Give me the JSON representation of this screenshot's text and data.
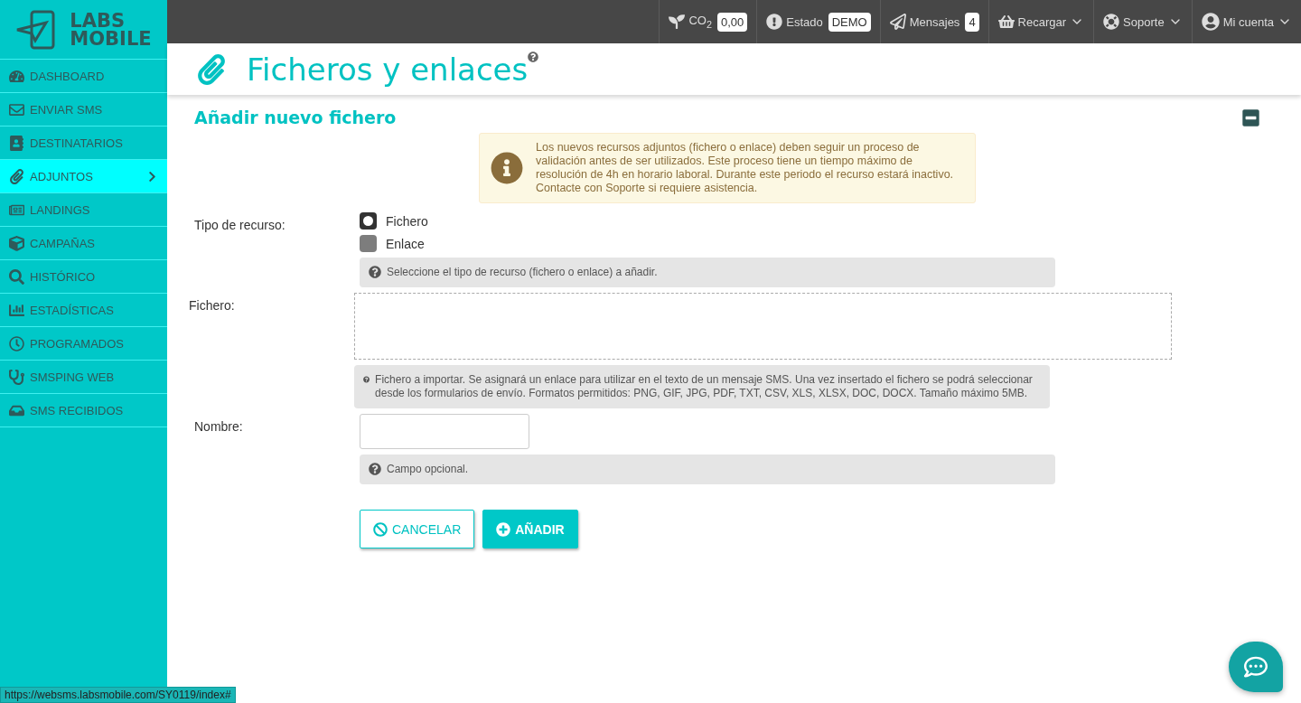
{
  "logo": {
    "line1": "LABS",
    "line2": "MOBILE"
  },
  "sidebar": {
    "items": [
      {
        "label": "DASHBOARD",
        "selected": false
      },
      {
        "label": "ENVIAR SMS",
        "selected": false
      },
      {
        "label": "DESTINATARIOS",
        "selected": false
      },
      {
        "label": "ADJUNTOS",
        "selected": true
      },
      {
        "label": "LANDINGS",
        "selected": false
      },
      {
        "label": "CAMPAÑAS",
        "selected": false
      },
      {
        "label": "HISTÓRICO",
        "selected": false
      },
      {
        "label": "ESTADÍSTICAS",
        "selected": false
      },
      {
        "label": "PROGRAMADOS",
        "selected": false
      },
      {
        "label": "SMSPING WEB",
        "selected": false
      },
      {
        "label": "SMS RECIBIDOS",
        "selected": false
      }
    ]
  },
  "topbar": {
    "items": [
      {
        "kind": "badge",
        "label": "CO$_{2}$",
        "badge": "0,00"
      },
      {
        "kind": "badge",
        "label": "Estado",
        "badge": "DEMO"
      },
      {
        "kind": "badge",
        "label": "Mensajes",
        "badge": "4"
      },
      {
        "kind": "menu",
        "label": "Recargar"
      },
      {
        "kind": "menu",
        "label": "Soporte"
      },
      {
        "kind": "menu",
        "label": "Mi cuenta"
      }
    ]
  },
  "page_title": "Ficheros y enlaces",
  "section": {
    "title": "Añadir nuevo fichero",
    "expanded": true
  },
  "notice": "Los nuevos recursos adjuntos (fichero o enlace) deben seguir un proceso de validación antes de ser utilizados. Este proceso tiene un tiempo máximo de resolución de 4h en horario laboral. Durante este periodo el recurso estará inactivo. Contacte con Soporte si requiere asistencia.",
  "form": {
    "type_label": "Tipo de recurso:",
    "options": [
      {
        "label": "Fichero",
        "selected": true
      },
      {
        "label": "Enlace",
        "selected": false
      }
    ],
    "type_help": "Seleccione el tipo de recurso (fichero o enlace) a añadir.",
    "file_label": "Fichero:",
    "file_help": "Fichero a importar. Se asignará un enlace para utilizar en el texto de un mensaje SMS. Una vez insertado el fichero se podrá seleccionar desde los formularios de envío. Formatos permitidos: PNG, GIF, JPG, PDF, TXT, CSV, XLS, XLSX, DOC, DOCX. Tamaño máximo 5MB.",
    "name_label": "Nombre:",
    "name_help": "Campo opcional."
  },
  "buttons": [
    {
      "kind": "cancel",
      "label": "CANCELAR"
    },
    {
      "kind": "primary",
      "label": "AÑADIR"
    }
  ],
  "status_url": "https://websms.labsmobile.com/SY0119/index#"
}
